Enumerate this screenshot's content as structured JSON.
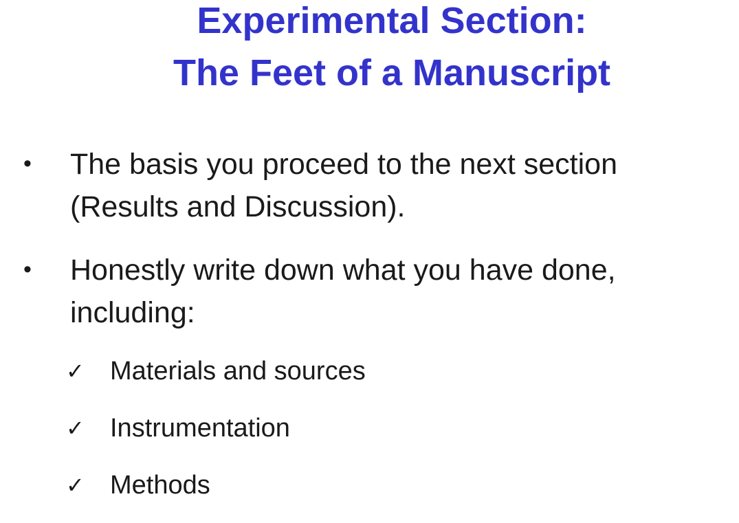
{
  "slide": {
    "title_line1": "Experimental Section:",
    "title_line2": "The Feet of a Manuscript",
    "title_color": "#3333cc",
    "bullets": [
      {
        "marker": "•",
        "text": "The basis you proceed to the next section (Results and Discussion)."
      },
      {
        "marker": "•",
        "text": "Honestly write down what you have done, including:"
      }
    ],
    "checklist": [
      {
        "marker": "✓",
        "text": "Materials and sources"
      },
      {
        "marker": "✓",
        "text": "Instrumentation"
      },
      {
        "marker": "✓",
        "text": "Methods"
      }
    ]
  }
}
